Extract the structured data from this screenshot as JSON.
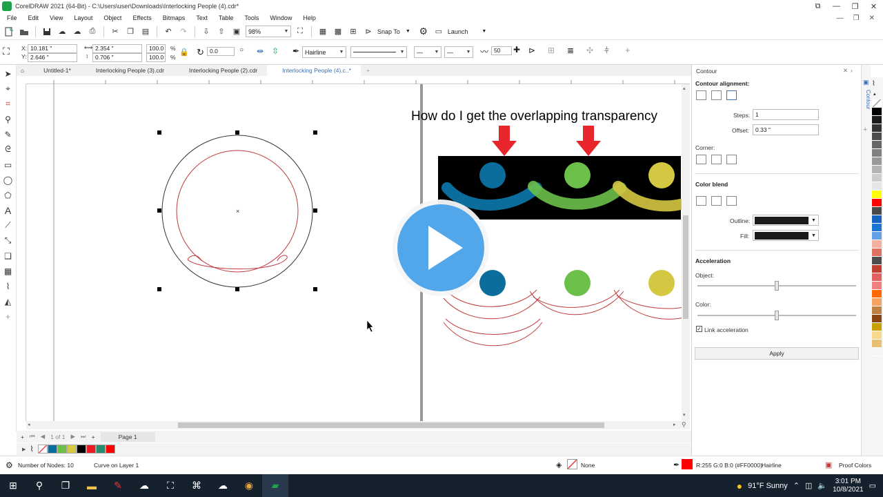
{
  "window": {
    "title": "CorelDRAW 2021 (64-Bit) - C:\\Users\\user\\Downloads\\Interlocking People (4).cdr*",
    "controls": [
      "⧉",
      "—",
      "❐",
      "✕"
    ]
  },
  "menu": {
    "items": [
      "File",
      "Edit",
      "View",
      "Layout",
      "Object",
      "Effects",
      "Bitmaps",
      "Text",
      "Table",
      "Tools",
      "Window",
      "Help"
    ],
    "right": [
      "—",
      "❐",
      "✕"
    ]
  },
  "toolbar": {
    "zoom": "98%",
    "snap_to": "Snap To",
    "launch": "Launch"
  },
  "propbar": {
    "x": "10.181 \"",
    "y": "2.646 \"",
    "w": "2.354 \"",
    "h": "0.706 \"",
    "scale_w": "100.0",
    "scale_h": "100.0",
    "pct": "%",
    "rotation": "0.0",
    "outline_width": "Hairline",
    "step": "50"
  },
  "tabs": [
    "Untitled-1*",
    "Interlocking People (3).cdr",
    "Interlocking People (2).cdr",
    "Interlocking People (4).c..*"
  ],
  "canvas": {
    "question": "How do I get the overlapping transparency"
  },
  "pagenav": {
    "counter": "1 of 1",
    "page_tab": "Page 1"
  },
  "doc_palette": [
    "#ffffff",
    "#0a6d9c",
    "#6cc04a",
    "#d4c741",
    "#000000",
    "#ec1c24",
    "#2a8c6e",
    "#ff0000"
  ],
  "status": {
    "nodes": "Number of Nodes: 10",
    "layer": "Curve on Layer 1",
    "fill": "None",
    "outline_color": "R:255 G:0 B:0 (#FF0000)",
    "outline_width": "Hairline",
    "proof": "Proof Colors",
    "outline_swatch": "#ff0000"
  },
  "docker": {
    "panel_title": "Contour",
    "side_tab": "Contour",
    "alignment_title": "Contour alignment:",
    "steps_label": "Steps:",
    "steps_value": "1",
    "offset_label": "Offset:",
    "offset_value": "0.33 \"",
    "corner_label": "Corner:",
    "color_blend_title": "Color blend",
    "outline_label": "Outline:",
    "fill_label": "Fill:",
    "acceleration_title": "Acceleration",
    "object_label": "Object:",
    "color_label": "Color:",
    "link_label": "Link acceleration",
    "apply_label": "Apply"
  },
  "color_palette": [
    "#ffffff",
    "#000000",
    "#1a1a1a",
    "#333333",
    "#4d4d4d",
    "#666666",
    "#808080",
    "#999999",
    "#b3b3b3",
    "#cccccc",
    "#e6e6e6",
    "#ffff00",
    "#ff0000",
    "#4a4a4a",
    "#1565c0",
    "#1976d2",
    "#64a0e6",
    "#f3b0a0",
    "#e07060",
    "#4d4d4d",
    "#c04030",
    "#e06060",
    "#f08080",
    "#ff6a00",
    "#f4a460",
    "#c08040",
    "#8b4513",
    "#c8a000",
    "#f8d88a",
    "#e8c070",
    "#f5f5f5"
  ],
  "taskbar": {
    "weather": "91°F  Sunny",
    "time": "3:01 PM",
    "date": "10/8/2021"
  }
}
